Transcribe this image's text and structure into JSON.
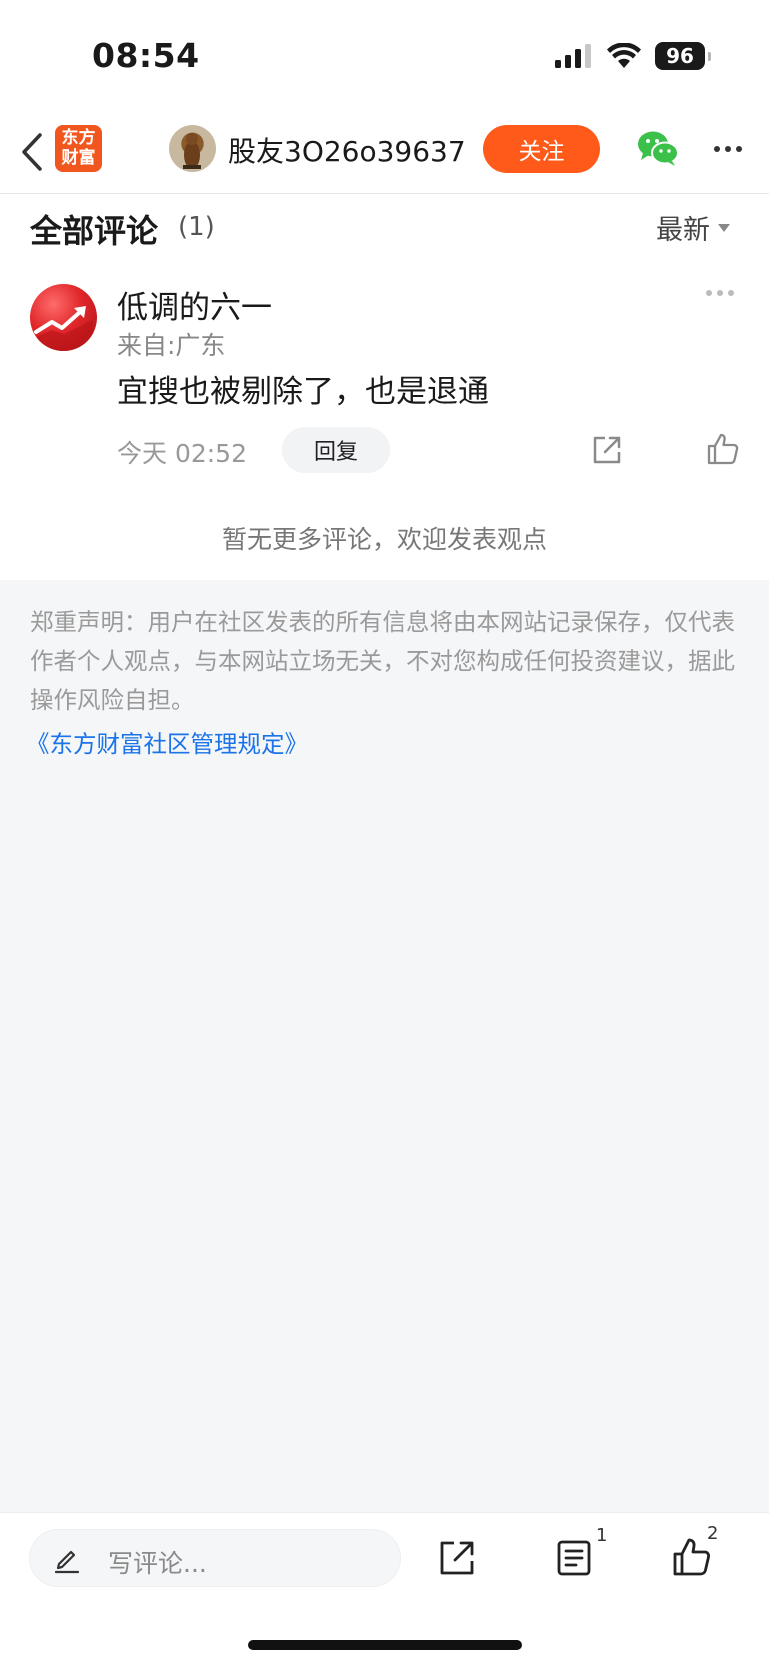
{
  "status_bar": {
    "time": "08:54",
    "battery": "96",
    "icons": [
      "signal-icon",
      "wifi-icon",
      "battery-icon"
    ]
  },
  "header": {
    "logo_line1": "东方",
    "logo_line2": "财富",
    "username": "股友3O26o39637",
    "follow_label": "关注",
    "icons": [
      "back-icon",
      "wechat-icon",
      "more-icon"
    ]
  },
  "comments": {
    "title": "全部评论",
    "count": "(1)",
    "sort_label": "最新",
    "items": [
      {
        "author": "低调的六一",
        "location": "来自:广东",
        "text": "宜搜也被剔除了，也是退通",
        "time": "今天 02:52",
        "reply_label": "回复"
      }
    ],
    "no_more_text": "暂无更多评论，欢迎发表观点"
  },
  "disclaimer": {
    "text": "郑重声明：用户在社区发表的所有信息将由本网站记录保存，仅代表作者个人观点，与本网站立场无关，不对您构成任何投资建议，据此操作风险自担。",
    "rules_link": "《东方财富社区管理规定》"
  },
  "bottom_bar": {
    "input_placeholder": "写评论...",
    "list_count": "1",
    "like_count": "2"
  },
  "colors": {
    "accent": "#ff5a1a",
    "logo": "#f0561d",
    "link": "#1a73e8",
    "wechat": "#3bc14a"
  }
}
